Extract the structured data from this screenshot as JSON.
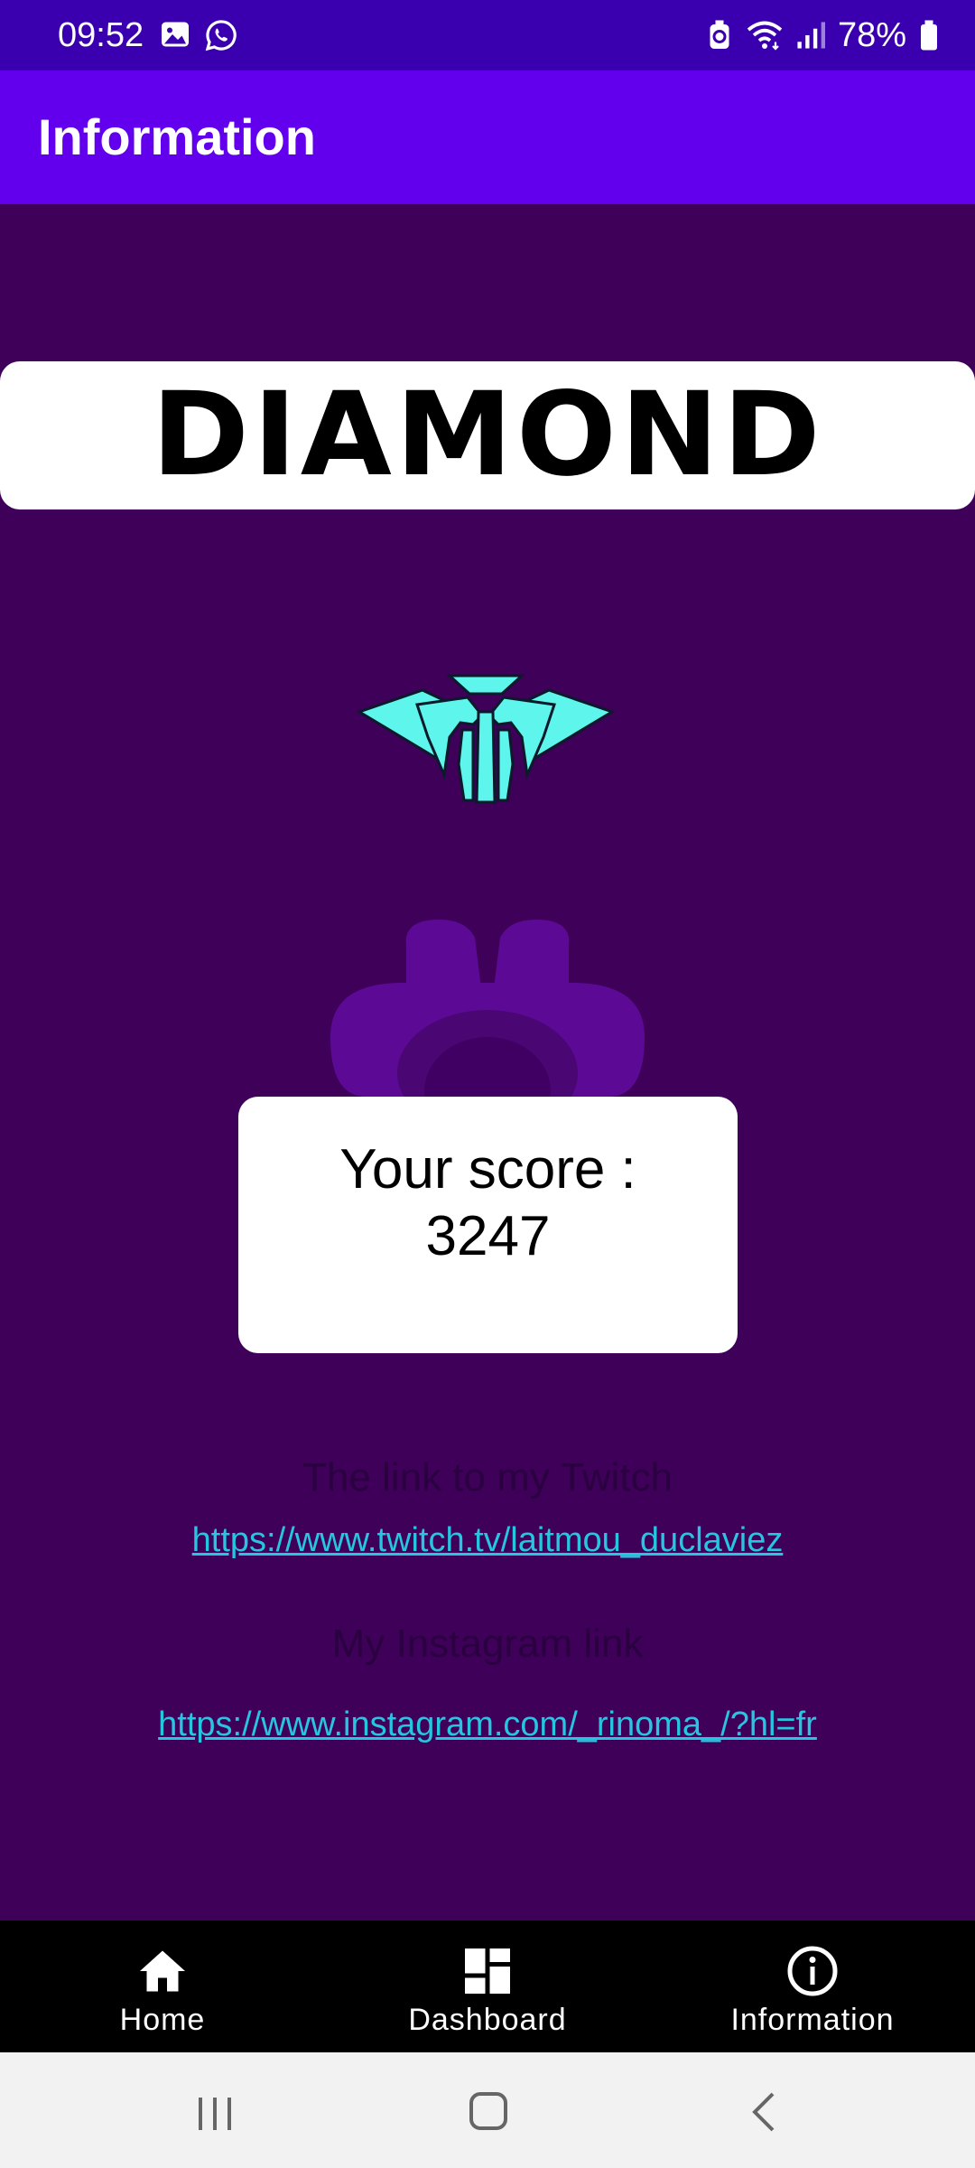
{
  "status_bar": {
    "time": "09:52",
    "battery_percent": "78%",
    "icons_left": [
      "gallery-icon",
      "whatsapp-icon"
    ],
    "icons_right": [
      "battery-saver-icon",
      "wifi-icon",
      "signal-icon",
      "battery-icon"
    ]
  },
  "app_bar": {
    "title": "Information"
  },
  "rank": {
    "name": "DIAMOND",
    "emblem_icon": "diamond-rank-emblem-icon",
    "emblem_color": "#5ef5ec"
  },
  "score": {
    "label": "Your score :",
    "value": "3247"
  },
  "links": {
    "twitch_heading": "The link to my Twitch",
    "twitch_url": "https://www.twitch.tv/laitmou_duclaviez",
    "instagram_heading": "My Instagram link",
    "instagram_url": "https://www.instagram.com/_rinoma_/?hl=fr"
  },
  "bottom_nav": {
    "items": [
      {
        "label": "Home",
        "icon": "home-icon"
      },
      {
        "label": "Dashboard",
        "icon": "dashboard-icon"
      },
      {
        "label": "Information",
        "icon": "info-icon"
      }
    ]
  },
  "system_nav": {
    "buttons": [
      "recents-icon",
      "home-circle-icon",
      "back-icon"
    ]
  },
  "colors": {
    "status_bar": "#3a00b0",
    "app_bar": "#6200ee",
    "background": "#3e0059",
    "link": "#27c6e0",
    "nav_bar": "#000000"
  }
}
